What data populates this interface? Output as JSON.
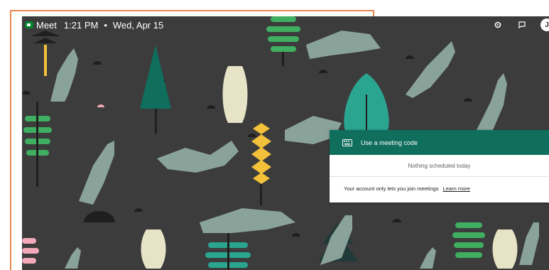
{
  "topbar": {
    "brand": "Meet",
    "time": "1:21 PM",
    "separator": "•",
    "date": "Wed, Apr 15",
    "avatar_initial": "J"
  },
  "card": {
    "head_label": "Use a meeting code",
    "status": "Nothing scheduled today",
    "account_notice": "Your account only lets you join meetings",
    "learn_more": "Learn more"
  },
  "colors": {
    "background": "#3c3c3c",
    "accent": "#0f6e5c",
    "frame": "#e8874a"
  }
}
